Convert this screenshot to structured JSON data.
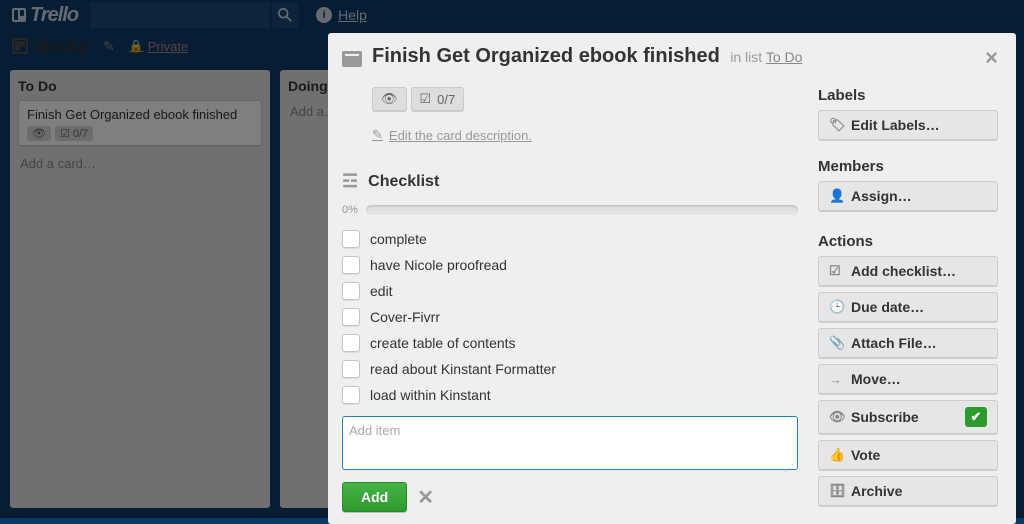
{
  "app": {
    "name": "Trello",
    "help": "Help"
  },
  "board": {
    "name": "Becky",
    "visibility": "Private"
  },
  "lists": [
    {
      "title": "To Do",
      "add_label": "Add a card…",
      "cards": [
        {
          "title": "Finish Get Organized ebook finished",
          "checklist_badge": "0/7"
        }
      ]
    },
    {
      "title": "Doing",
      "add_label": "Add a…"
    }
  ],
  "card_modal": {
    "title": "Finish Get Organized ebook finished",
    "in_list_prefix": "in list",
    "in_list": "To Do",
    "checklist_badge": "0/7",
    "edit_description": "Edit the card description.",
    "close": "×"
  },
  "checklist": {
    "title": "Checklist",
    "percent": "0%",
    "items": [
      "complete",
      "have Nicole proofread",
      "edit",
      "Cover-Fivrr",
      "create table of contents",
      "read about Kinstant Formatter",
      "load within Kinstant"
    ],
    "add_placeholder": "Add item",
    "add_button": "Add"
  },
  "sidebar": {
    "labels_heading": "Labels",
    "edit_labels": "Edit Labels…",
    "members_heading": "Members",
    "assign": "Assign…",
    "actions_heading": "Actions",
    "add_checklist": "Add checklist…",
    "due_date": "Due date…",
    "attach": "Attach File…",
    "move": "Move…",
    "subscribe": "Subscribe",
    "vote": "Vote",
    "archive": "Archive"
  }
}
